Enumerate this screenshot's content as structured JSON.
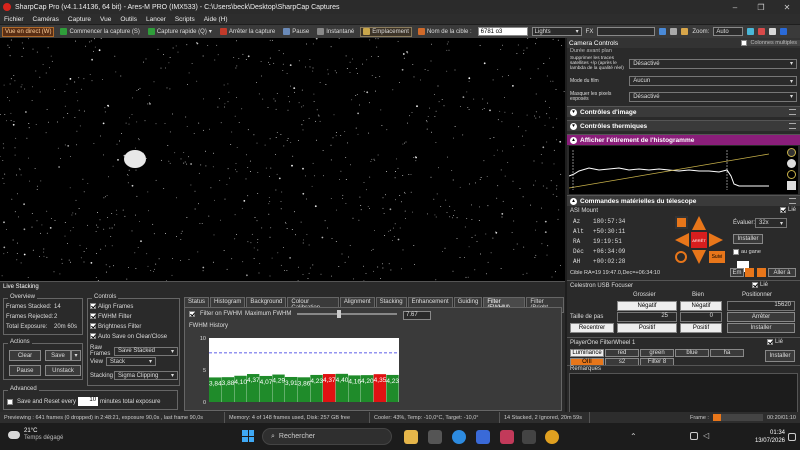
{
  "window": {
    "title": "SharpCap Pro (v4.1.14136, 64 bit) - Ares-M PRO (IMX533) - C:\\Users\\beck\\Desktop\\SharpCap Captures",
    "controls": [
      "–",
      "❐",
      "✕"
    ]
  },
  "menu": [
    "Fichier",
    "Caméras",
    "Capture",
    "Vue",
    "Outils",
    "Lancer",
    "Scripts",
    "Aide (H)"
  ],
  "toolbar": {
    "live": "Vue en direct (W)",
    "start": "Commencer la capture (S)",
    "quick": "Capture rapide (Q)",
    "stop": "Arrêter la capture",
    "pause": "Pause",
    "snapshot": "Instantané",
    "location": "Emplacement",
    "target_label": "Nom de la cible :",
    "target_value": "6781 o3",
    "frame_type": "Lights",
    "fx_label": "FX",
    "zoom_label": "Zoom:",
    "zoom_value": "Auto"
  },
  "camera_controls": {
    "title": "Camera Controls",
    "multi_columns": "Colonnes multiples",
    "frag": "Durée avant plan",
    "rows": [
      {
        "label": "Supprimer les traces satellites +/p (après le lambda de la qualité réel)",
        "value": "Désactivé"
      },
      {
        "label": "Mode du film",
        "value": "Aucun"
      },
      {
        "label": "Masquer les pixels exposés",
        "value": "Désactivé"
      }
    ],
    "sections": {
      "image": "Contrôles d'image",
      "thermal": "Contrôles thermiques",
      "histogram": "Afficher l'étirement de l'histogramme",
      "telescope": "Commandes matérielles du télescope"
    }
  },
  "mount": {
    "title": "ASI Mount",
    "linked": "Lié",
    "coords": [
      {
        "k": "Az",
        "v": "180:57:34"
      },
      {
        "k": "Alt",
        "v": "+50:30:11"
      },
      {
        "k": "RA",
        "v": "19:19:51"
      },
      {
        "k": "Déc",
        "v": "+06:34:09"
      },
      {
        "k": "AH",
        "v": "+00:02:28"
      }
    ],
    "rate_label": "Évaluer:",
    "rate": "32x",
    "stop": "ARRÊT",
    "install": "Installer",
    "follow": "Suivi",
    "southern": "au gane",
    "cible": "Cible  RA=19 19:47.0,Dec=+06:34:10",
    "go": "Aller à",
    "en": "Em"
  },
  "focuser": {
    "title": "Celestron USB Focuser",
    "linked": "Lié",
    "coarse": "Grossier",
    "fine": "Bien",
    "position": "Positionner",
    "neg": "Négatif",
    "pos": "Positif",
    "pos_value": "15620",
    "step_label": "Taille de pas",
    "coarse_step": "25",
    "fine_step": "0",
    "stop": "Arrêter",
    "reset": "Recentrer",
    "install": "Installer"
  },
  "filterwheel": {
    "title": "PlayerOne FilterWheel 1",
    "linked": "Lié",
    "filters": [
      "Luminance",
      "red",
      "green",
      "blue",
      "ha",
      "OIII",
      "s2",
      "Filter 8"
    ],
    "install": "Installer"
  },
  "remarks": "Remarques",
  "live_stacking": {
    "title": "Live Stacking",
    "overview": {
      "title": "Overview",
      "frames_stacked_label": "Frames Stacked:",
      "frames_stacked": "14",
      "frames_rejected_label": "Frames Rejected:",
      "frames_rejected": "2",
      "total_exposure_label": "Total Exposure:",
      "total_exposure": "20m 60s"
    },
    "actions": {
      "title": "Actions",
      "clear": "Clear",
      "save": "Save",
      "pause": "Pause",
      "unstack": "Unstack"
    },
    "advanced": {
      "title": "Advanced",
      "save_reset": "Save and Reset every",
      "minutes": "10",
      "minutes_suffix": "minutes total exposure"
    },
    "controls": {
      "title": "Controls",
      "align": "Align Frames",
      "fwhm": "FWHM Filter",
      "brightness": "Brightness Filter",
      "autosave": "Auto Save on Clear/Close",
      "raw_label": "Raw Frames",
      "raw_value": "Save Stacked",
      "view_label": "View",
      "view_value": "Stack",
      "stacking_label": "Stacking",
      "stacking_value": "Sigma Clipping"
    },
    "tabs": [
      "Status",
      "Histogram",
      "Background",
      "Colour Calibration",
      "Alignment",
      "Stacking",
      "Enhancement",
      "Guiding",
      "Filter (FWHM)",
      "Filter (Bright"
    ],
    "filter_on": "Filter on FWHM",
    "max_fwhm_label": "Maximum FWHM",
    "max_fwhm": "7.67",
    "history": "FWHM History"
  },
  "chart_data": {
    "type": "bar",
    "values": [
      3.84,
      3.88,
      4.1,
      4.37,
      4.07,
      4.29,
      3.91,
      3.86,
      4.23,
      4.37,
      4.4,
      4.16,
      4.2,
      4.35,
      4.23
    ],
    "labels": [
      "3,84",
      "3,88",
      "4,10",
      "4,37",
      "4,07",
      "4,29",
      "3,91",
      "3,86",
      "4,23",
      "4,37",
      "4,40",
      "4,16",
      "4,20",
      "4,35",
      "4,23"
    ],
    "rejected": [
      false,
      false,
      false,
      false,
      false,
      false,
      false,
      false,
      false,
      true,
      false,
      false,
      false,
      true,
      false
    ],
    "yticks": [
      "0",
      "5",
      "10"
    ],
    "ylim": [
      0,
      10
    ],
    "threshold": 7.67,
    "colors": {
      "accepted": "#1f8b2a",
      "rejected": "#e01212",
      "threshold": "#2a2ae0"
    }
  },
  "status": {
    "preview": "Previewing : 641 frames (0 dropped) in 2:48:21, exposure 90,0s , last frame 90,0s",
    "memory": "Memory: 4 of 148 frames used, Disk: 257 GB free",
    "cooler": "Cooler: 43%, Temp: -10,0°C, Target: -10,0°",
    "stacked": "14 Stacked, 2 Ignored, 20m 59s",
    "frame_label": "Frame :",
    "time": "00:20/01:10"
  },
  "taskbar": {
    "temp": "21°C",
    "weather": "Temps dégagé",
    "search": "Rechercher",
    "clock": "01:34",
    "date": "13/07/2026"
  },
  "accent": "#e8761a"
}
